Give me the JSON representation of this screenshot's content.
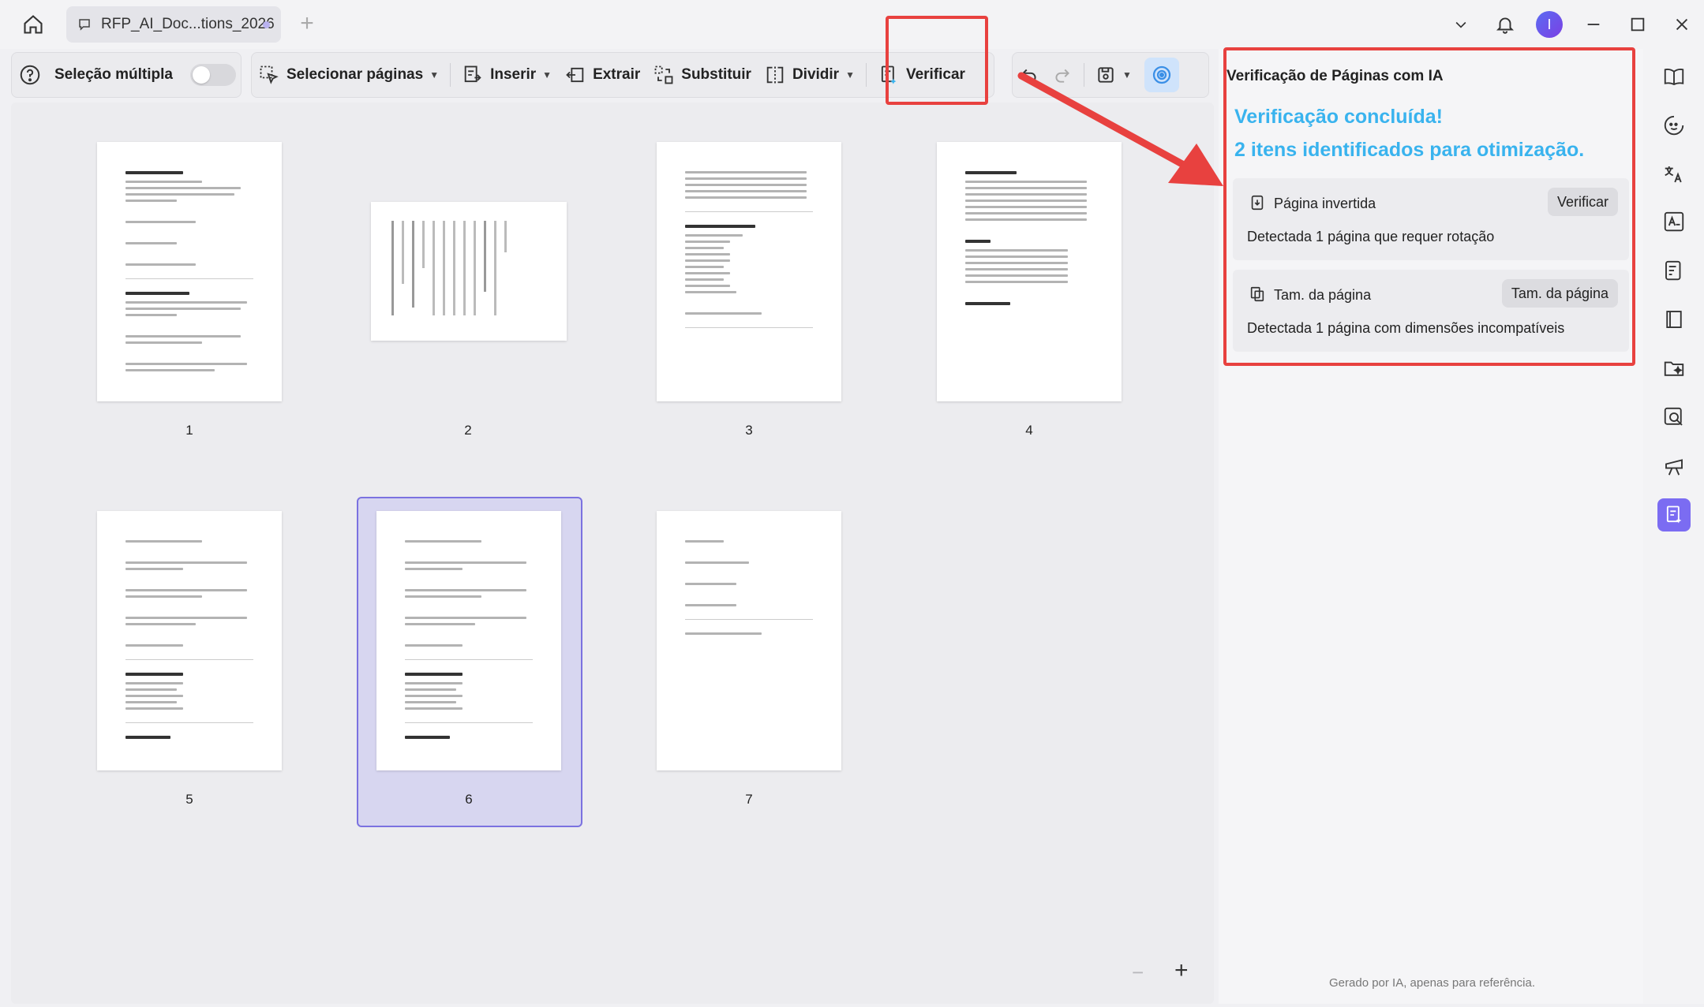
{
  "app": {
    "tab_title": "RFP_AI_Doc...tions_2026",
    "avatar_initial": "I"
  },
  "toolbar": {
    "multi_select_label": "Seleção múltipla",
    "select_pages_label": "Selecionar páginas",
    "insert_label": "Inserir",
    "extract_label": "Extrair",
    "replace_label": "Substituir",
    "split_label": "Dividir",
    "verify_label": "Verificar"
  },
  "pages": [
    {
      "number": "1"
    },
    {
      "number": "2"
    },
    {
      "number": "3"
    },
    {
      "number": "4"
    },
    {
      "number": "5"
    },
    {
      "number": "6",
      "selected": true
    },
    {
      "number": "7"
    }
  ],
  "zoom": {
    "minus": "−",
    "plus": "+"
  },
  "panel": {
    "title": "Verificação de Páginas com IA",
    "status_line1": "Verificação concluída!",
    "status_line2": "2 itens identificados para otimização.",
    "issues": [
      {
        "icon": "rotate-page-icon",
        "title": "Página invertida",
        "action": "Verificar",
        "description": "Detectada 1 página que requer rotação"
      },
      {
        "icon": "page-size-icon",
        "title": "Tam. da página",
        "action": "Tam. da página",
        "description": "Detectada 1 página com dimensões incompatíveis"
      }
    ],
    "footer": "Gerado por IA, apenas para referência."
  },
  "rail": [
    "book-open-icon",
    "ai-chat-icon",
    "translate-icon",
    "ocr-icon",
    "summarize-icon",
    "book-icon",
    "folder-ai-icon",
    "search-ai-icon",
    "presentation-icon",
    "page-verify-icon"
  ],
  "colors": {
    "accent": "#7b6cf2",
    "status": "#39b3ee",
    "annotation": "#e8413f",
    "selection": "#d7d6f0"
  }
}
